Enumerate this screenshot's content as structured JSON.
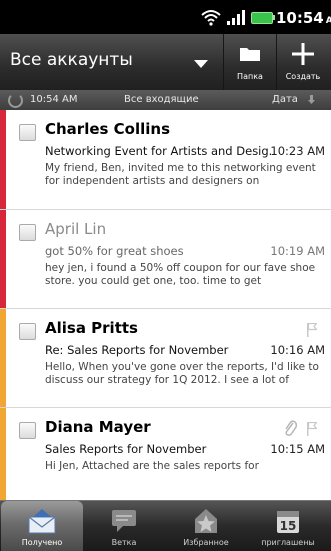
{
  "status": {
    "time": "10:54",
    "ampm": "AM"
  },
  "header": {
    "account": "Все аккаунты",
    "folder_label": "Папка",
    "create_label": "Создать"
  },
  "subbar": {
    "time": "10:54 AM",
    "mailbox": "Все входящие",
    "sort": "Дата"
  },
  "emails": [
    {
      "from": "Charles Collins",
      "subject": "Networking Event for Artists and Desig...",
      "time": "10:23 AM",
      "preview": "My friend, Ben, invited me to this networking event for independent artists and designers on",
      "stripe": "#d6283a",
      "unread": true
    },
    {
      "from": "April Lin",
      "subject": "got 50% for great shoes",
      "time": "10:19 AM",
      "preview": "hey jen,   i found a 50% off coupon for our fave shoe store. you could get one, too. time to get",
      "stripe": "#d6283a",
      "unread": false
    },
    {
      "from": "Alisa Pritts",
      "subject": "Re: Sales Reports for November",
      "time": "10:16 AM",
      "preview": "Hello, When you've gone over the reports, I'd like to discuss our strategy for 1Q 2012. I see a lot of",
      "stripe": "#f2a633",
      "unread": true
    },
    {
      "from": "Diana Mayer",
      "subject": "Sales Reports for November",
      "time": "10:15 AM",
      "preview": "Hi Jen, Attached are the sales reports for",
      "stripe": "#f2a633",
      "unread": true
    }
  ],
  "tabs": [
    {
      "label": "Получено",
      "icon": "inbox-envelope-icon",
      "active": true
    },
    {
      "label": "Ветка",
      "icon": "conversation-icon",
      "active": false
    },
    {
      "label": "Избранное",
      "icon": "favorites-star-icon",
      "active": false
    },
    {
      "label": "приглашены",
      "icon": "calendar-invite-icon",
      "active": false,
      "badge": "15"
    }
  ]
}
